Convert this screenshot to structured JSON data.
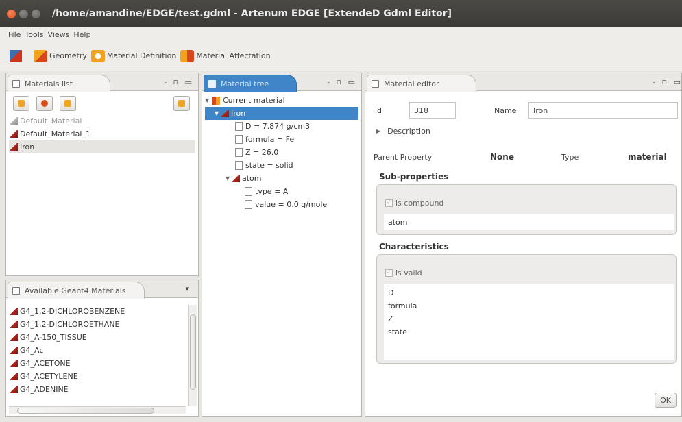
{
  "window": {
    "title": "/home/amandine/EDGE/test.gdml - Artenum EDGE [ExtendeD Gdml Editor]"
  },
  "menu": [
    "File",
    "Tools",
    "Views",
    "Help"
  ],
  "toolbar": {
    "items": [
      {
        "label": "",
        "icon": "tools-icon"
      },
      {
        "label": "Geometry",
        "icon": "geometry-icon"
      },
      {
        "label": "Material Definition",
        "icon": "material-definition-icon"
      },
      {
        "label": "Material Affectation",
        "icon": "material-affectation-icon"
      }
    ]
  },
  "materials_list": {
    "tab": "Materials list",
    "controls": "- ▫ ▭",
    "items": [
      {
        "label": "Default_Material",
        "dim": true
      },
      {
        "label": "Default_Material_1",
        "dim": false
      },
      {
        "label": "Iron",
        "dim": false,
        "selected": true
      }
    ]
  },
  "geant4": {
    "tab": "Available Geant4 Materials",
    "dropdown": "▾",
    "items": [
      "G4_1,2-DICHLOROBENZENE",
      "G4_1,2-DICHLOROETHANE",
      "G4_A-150_TISSUE",
      "G4_Ac",
      "G4_ACETONE",
      "G4_ACETYLENE",
      "G4_ADENINE"
    ]
  },
  "material_tree": {
    "tab": "Material tree",
    "controls": "- ▫ ▭",
    "rows": {
      "root": "Current material",
      "iron": "Iron",
      "d": "D = 7.874 g/cm3",
      "formula": "formula = Fe",
      "z": "Z = 26.0",
      "state": "state = solid",
      "atom": "atom",
      "type": "type = A",
      "value": "value = 0.0 g/mole"
    }
  },
  "editor": {
    "tab": "Material editor",
    "controls": "- ▫ ▭",
    "id_label": "id",
    "id_value": "318",
    "name_label": "Name",
    "name_value": "Iron",
    "description": "Description",
    "parent_label": "Parent Property",
    "parent_value": "None",
    "type_label": "Type",
    "type_value": "material",
    "sub_title": "Sub-properties",
    "is_compound": "is compound",
    "sub_items": [
      "atom"
    ],
    "char_title": "Characteristics",
    "is_valid": "is valid",
    "char_items": [
      "D",
      "formula",
      "Z",
      "state"
    ],
    "ok": "OK"
  }
}
